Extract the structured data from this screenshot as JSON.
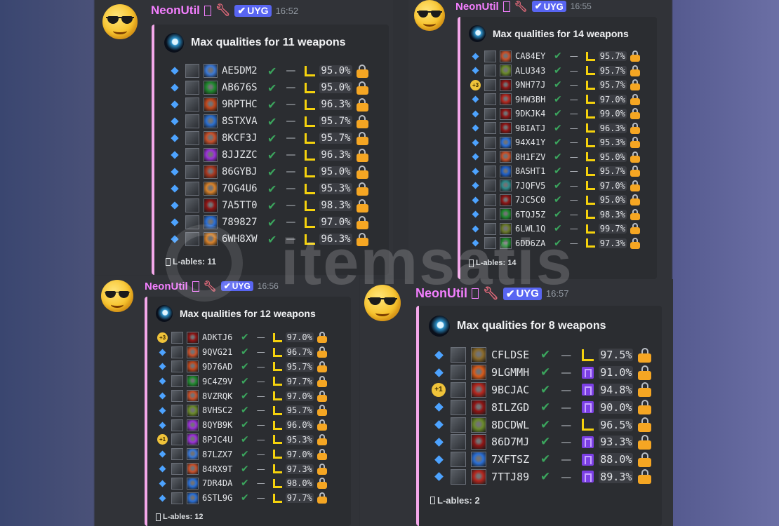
{
  "watermark": "itemsatis",
  "colors": {
    "username": "#f47fff",
    "tag": "#5865f2",
    "embed_border": "#f4a8ea",
    "check": "#3ba55d",
    "lock": "#f5a623",
    "diamond": "#4da3ff"
  },
  "messages": [
    {
      "username": "NeonUtil",
      "wrench_icon": "wrench-icon",
      "tag": "UYG",
      "time": "16:52",
      "title": "Max qualities for 11 weapons",
      "footer": "L-ables: 11",
      "rows": [
        {
          "code": "AE5DM2",
          "pct": "95.0%",
          "q": "L",
          "badge": "",
          "icon_color": "#3a78d6"
        },
        {
          "code": "AB676S",
          "pct": "95.0%",
          "q": "L",
          "badge": "",
          "icon_color": "#1f8a2e"
        },
        {
          "code": "9RPTHC",
          "pct": "96.3%",
          "q": "L",
          "badge": "",
          "icon_color": "#c0471c"
        },
        {
          "code": "8STXVA",
          "pct": "95.7%",
          "q": "L",
          "badge": "",
          "icon_color": "#2b6fd0"
        },
        {
          "code": "8KCF3J",
          "pct": "95.7%",
          "q": "L",
          "badge": "",
          "icon_color": "#c8502a"
        },
        {
          "code": "8JJZZC",
          "pct": "96.3%",
          "q": "L",
          "badge": "",
          "icon_color": "#9b32d8"
        },
        {
          "code": "86GYBJ",
          "pct": "95.0%",
          "q": "L",
          "badge": "",
          "icon_color": "#a8361e"
        },
        {
          "code": "7QG4U6",
          "pct": "95.3%",
          "q": "L",
          "badge": "",
          "icon_color": "#d8822a"
        },
        {
          "code": "7A5TT0",
          "pct": "98.3%",
          "q": "L",
          "badge": "",
          "icon_color": "#8e1414"
        },
        {
          "code": "789827",
          "pct": "97.0%",
          "q": "L",
          "badge": "",
          "icon_color": "#2a6fd6"
        },
        {
          "code": "6WH8XW",
          "pct": "96.3%",
          "q": "L",
          "badge": "",
          "icon_color": "#d8822a"
        }
      ]
    },
    {
      "username": "NeonUtil",
      "wrench_icon": "wrench-icon",
      "tag": "UYG",
      "time": "16:55",
      "title": "Max qualities for 14 weapons",
      "footer": "L-ables: 14",
      "rows": [
        {
          "code": "CA84EY",
          "pct": "95.7%",
          "q": "L",
          "badge": "",
          "icon_color": "#c8502a"
        },
        {
          "code": "ALU343",
          "pct": "95.7%",
          "q": "L",
          "badge": "",
          "icon_color": "#6a8a2a"
        },
        {
          "code": "9NH77J",
          "pct": "95.7%",
          "q": "L",
          "badge": "+3",
          "icon_color": "#8e1414"
        },
        {
          "code": "9HW3BH",
          "pct": "97.0%",
          "q": "L",
          "badge": "",
          "icon_color": "#b3261e"
        },
        {
          "code": "9DKJK4",
          "pct": "99.0%",
          "q": "L",
          "badge": "",
          "icon_color": "#8e1414"
        },
        {
          "code": "9BIATJ",
          "pct": "96.3%",
          "q": "L",
          "badge": "",
          "icon_color": "#8e1414"
        },
        {
          "code": "94X41Y",
          "pct": "95.3%",
          "q": "L",
          "badge": "",
          "icon_color": "#2a6fd6"
        },
        {
          "code": "8H1FZV",
          "pct": "95.0%",
          "q": "L",
          "badge": "",
          "icon_color": "#c8502a"
        },
        {
          "code": "8ASHT1",
          "pct": "95.7%",
          "q": "L",
          "badge": "",
          "icon_color": "#1e5fc8"
        },
        {
          "code": "7JQFV5",
          "pct": "97.0%",
          "q": "L",
          "badge": "",
          "icon_color": "#2d8a8a"
        },
        {
          "code": "7JC5C0",
          "pct": "95.0%",
          "q": "L",
          "badge": "",
          "icon_color": "#8e1414"
        },
        {
          "code": "6TQJ5Z",
          "pct": "98.3%",
          "q": "L",
          "badge": "",
          "icon_color": "#1f8a2e"
        },
        {
          "code": "6LWL1Q",
          "pct": "99.7%",
          "q": "L",
          "badge": "",
          "icon_color": "#6a7a2a"
        },
        {
          "code": "6DD6ZA",
          "pct": "97.3%",
          "q": "L",
          "badge": "",
          "icon_color": "#1f8a2e"
        }
      ]
    },
    {
      "username": "NeonUtil",
      "wrench_icon": "wrench-icon",
      "tag": "UYG",
      "time": "16:56",
      "title": "Max qualities for 12 weapons",
      "footer": "L-ables: 12",
      "rows": [
        {
          "code": "ADKTJ6",
          "pct": "97.0%",
          "q": "L",
          "badge": "+3",
          "icon_color": "#8e1414"
        },
        {
          "code": "9QVG21",
          "pct": "96.7%",
          "q": "L",
          "badge": "",
          "icon_color": "#c8502a"
        },
        {
          "code": "9D76AD",
          "pct": "95.7%",
          "q": "L",
          "badge": "",
          "icon_color": "#c0471c"
        },
        {
          "code": "9C4Z9V",
          "pct": "97.7%",
          "q": "L",
          "badge": "",
          "icon_color": "#1f8a2e"
        },
        {
          "code": "8VZRQK",
          "pct": "97.0%",
          "q": "L",
          "badge": "",
          "icon_color": "#c8502a"
        },
        {
          "code": "8VHSC2",
          "pct": "95.7%",
          "q": "L",
          "badge": "",
          "icon_color": "#6a8a2a"
        },
        {
          "code": "8QYB9K",
          "pct": "96.0%",
          "q": "L",
          "badge": "",
          "icon_color": "#9b32d8"
        },
        {
          "code": "8PJC4U",
          "pct": "95.3%",
          "q": "L",
          "badge": "+1",
          "icon_color": "#9b32d8"
        },
        {
          "code": "87LZX7",
          "pct": "97.0%",
          "q": "L",
          "badge": "",
          "icon_color": "#3a78d6"
        },
        {
          "code": "84RX9T",
          "pct": "97.3%",
          "q": "L",
          "badge": "",
          "icon_color": "#c8502a"
        },
        {
          "code": "7DR4DA",
          "pct": "98.0%",
          "q": "L",
          "badge": "",
          "icon_color": "#2a6fd6"
        },
        {
          "code": "6STL9G",
          "pct": "97.7%",
          "q": "L",
          "badge": "",
          "icon_color": "#2a6fd6"
        }
      ]
    },
    {
      "username": "NeonUtil",
      "wrench_icon": "wrench-icon",
      "tag": "UYG",
      "time": "16:57",
      "title": "Max qualities for 8 weapons",
      "footer": "L-ables: 2",
      "rows": [
        {
          "code": "CFLDSE",
          "pct": "97.5%",
          "q": "L",
          "badge": "",
          "icon_color": "#8a6a2a"
        },
        {
          "code": "9LGMMH",
          "pct": "91.0%",
          "q": "M",
          "badge": "",
          "icon_color": "#d85a1a"
        },
        {
          "code": "9BCJAC",
          "pct": "94.8%",
          "q": "M",
          "badge": "+1",
          "icon_color": "#b3261e"
        },
        {
          "code": "8ILZGD",
          "pct": "90.0%",
          "q": "M",
          "badge": "",
          "icon_color": "#8e1414"
        },
        {
          "code": "8DCDWL",
          "pct": "96.5%",
          "q": "L",
          "badge": "",
          "icon_color": "#6a8a2a"
        },
        {
          "code": "86D7MJ",
          "pct": "93.3%",
          "q": "M",
          "badge": "",
          "icon_color": "#8e1414"
        },
        {
          "code": "7XFTSZ",
          "pct": "88.0%",
          "q": "M",
          "badge": "",
          "icon_color": "#2a6fd6"
        },
        {
          "code": "7TTJ89",
          "pct": "89.3%",
          "q": "M",
          "badge": "",
          "icon_color": "#b3261e"
        }
      ]
    }
  ]
}
